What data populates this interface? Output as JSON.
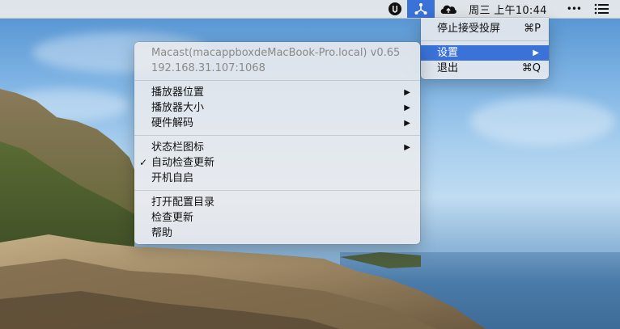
{
  "colors": {
    "highlight": "#3a72d8",
    "menubar_bg": "#ececec",
    "disabled_text": "#8a8a8a"
  },
  "menubar": {
    "icons": [
      "macast-shield-icon",
      "macast-network-icon",
      "cloud-icon",
      "more-icon",
      "notification-list-icon"
    ],
    "clock": "周三 上午10:44",
    "more": "•••"
  },
  "app_menu": {
    "items": [
      {
        "label": "停止接受投屏",
        "shortcut": "⌘P"
      },
      {
        "label": "设置",
        "submenu_arrow": "▶"
      },
      {
        "label": "退出",
        "shortcut": "⌘Q"
      }
    ]
  },
  "main_menu": {
    "header": {
      "title": "Macast(macappboxdeMacBook-Pro.local) v0.65",
      "address": "192.168.31.107:1068"
    },
    "group1": [
      {
        "label": "播放器位置",
        "arrow": "▶"
      },
      {
        "label": "播放器大小",
        "arrow": "▶"
      },
      {
        "label": "硬件解码",
        "arrow": "▶"
      }
    ],
    "group2": [
      {
        "label": "状态栏图标",
        "arrow": "▶"
      },
      {
        "label": "自动检查更新",
        "check": "✓"
      },
      {
        "label": "开机自启"
      }
    ],
    "group3": [
      {
        "label": "打开配置目录"
      },
      {
        "label": "检查更新"
      },
      {
        "label": "帮助"
      }
    ]
  }
}
